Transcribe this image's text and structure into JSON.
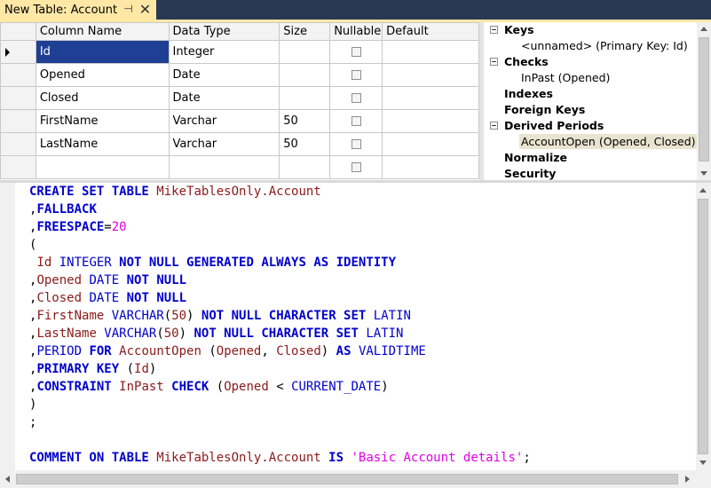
{
  "tab": {
    "title": "New Table: Account",
    "pin_icon": "pin-icon",
    "close_icon": "close-icon"
  },
  "grid": {
    "columns": [
      "Column Name",
      "Data Type",
      "Size",
      "Nullable",
      "Default"
    ],
    "rows": [
      {
        "name": "Id",
        "type": "Integer",
        "size": "",
        "nullable": false,
        "default": "",
        "selected": true
      },
      {
        "name": "Opened",
        "type": "Date",
        "size": "",
        "nullable": false,
        "default": ""
      },
      {
        "name": "Closed",
        "type": "Date",
        "size": "",
        "nullable": false,
        "default": ""
      },
      {
        "name": "FirstName",
        "type": "Varchar",
        "size": "50",
        "nullable": false,
        "default": ""
      },
      {
        "name": "LastName",
        "type": "Varchar",
        "size": "50",
        "nullable": false,
        "default": ""
      },
      {
        "name": "",
        "type": "",
        "size": "",
        "nullable": false,
        "default": ""
      }
    ]
  },
  "tree": {
    "keys": "Keys",
    "keys_child": "<unnamed> (Primary Key: Id)",
    "checks": "Checks",
    "checks_child": "InPast (Opened)",
    "indexes": "Indexes",
    "foreign_keys": "Foreign Keys",
    "derived_periods": "Derived Periods",
    "derived_child": "AccountOpen (Opened, Closed)",
    "normalize": "Normalize",
    "security": "Security"
  },
  "sql": [
    [
      [
        "kw",
        "CREATE SET TABLE "
      ],
      [
        "obj",
        "MikeTablesOnly.Account"
      ]
    ],
    [
      [
        "pun",
        ","
      ],
      [
        "kw",
        "FALLBACK"
      ]
    ],
    [
      [
        "pun",
        ","
      ],
      [
        "kw",
        "FREESPACE"
      ],
      [
        "pun",
        "="
      ],
      [
        "num",
        "20"
      ]
    ],
    [
      [
        "pun",
        "("
      ]
    ],
    [
      [
        "pun",
        " "
      ],
      [
        "obj",
        "Id "
      ],
      [
        "kw2",
        "INTEGER "
      ],
      [
        "kw",
        "NOT NULL GENERATED ALWAYS AS IDENTITY"
      ]
    ],
    [
      [
        "pun",
        ","
      ],
      [
        "obj",
        "Opened "
      ],
      [
        "kw2",
        "DATE "
      ],
      [
        "kw",
        "NOT NULL"
      ]
    ],
    [
      [
        "pun",
        ","
      ],
      [
        "obj",
        "Closed "
      ],
      [
        "kw2",
        "DATE "
      ],
      [
        "kw",
        "NOT NULL"
      ]
    ],
    [
      [
        "pun",
        ","
      ],
      [
        "obj",
        "FirstName "
      ],
      [
        "kw2",
        "VARCHAR"
      ],
      [
        "pun",
        "("
      ],
      [
        "obj",
        "50"
      ],
      [
        "pun",
        ") "
      ],
      [
        "kw",
        "NOT NULL CHARACTER SET "
      ],
      [
        "kw2",
        "LATIN"
      ]
    ],
    [
      [
        "pun",
        ","
      ],
      [
        "obj",
        "LastName "
      ],
      [
        "kw2",
        "VARCHAR"
      ],
      [
        "pun",
        "("
      ],
      [
        "obj",
        "50"
      ],
      [
        "pun",
        ") "
      ],
      [
        "kw",
        "NOT NULL CHARACTER SET "
      ],
      [
        "kw2",
        "LATIN"
      ]
    ],
    [
      [
        "pun",
        ","
      ],
      [
        "kw2",
        "PERIOD "
      ],
      [
        "kw",
        "FOR "
      ],
      [
        "obj",
        "AccountOpen "
      ],
      [
        "pun",
        "("
      ],
      [
        "obj",
        "Opened"
      ],
      [
        "pun",
        ", "
      ],
      [
        "obj",
        "Closed"
      ],
      [
        "pun",
        ") "
      ],
      [
        "kw",
        "AS "
      ],
      [
        "kw2",
        "VALIDTIME"
      ]
    ],
    [
      [
        "pun",
        ","
      ],
      [
        "kw",
        "PRIMARY KEY "
      ],
      [
        "pun",
        "("
      ],
      [
        "obj",
        "Id"
      ],
      [
        "pun",
        ")"
      ]
    ],
    [
      [
        "pun",
        ","
      ],
      [
        "kw",
        "CONSTRAINT "
      ],
      [
        "obj",
        "InPast "
      ],
      [
        "kw",
        "CHECK "
      ],
      [
        "pun",
        "("
      ],
      [
        "obj",
        "Opened "
      ],
      [
        "pun",
        "< "
      ],
      [
        "kw2",
        "CURRENT_DATE"
      ],
      [
        "pun",
        ")"
      ]
    ],
    [
      [
        "pun",
        ")"
      ]
    ],
    [
      [
        "pun",
        ";"
      ]
    ],
    [
      [
        "pun",
        ""
      ]
    ],
    [
      [
        "kw",
        "COMMENT ON TABLE "
      ],
      [
        "obj",
        "MikeTablesOnly.Account "
      ],
      [
        "kw",
        "IS "
      ],
      [
        "str",
        "'Basic Account details'"
      ],
      [
        "pun",
        ";"
      ]
    ]
  ]
}
